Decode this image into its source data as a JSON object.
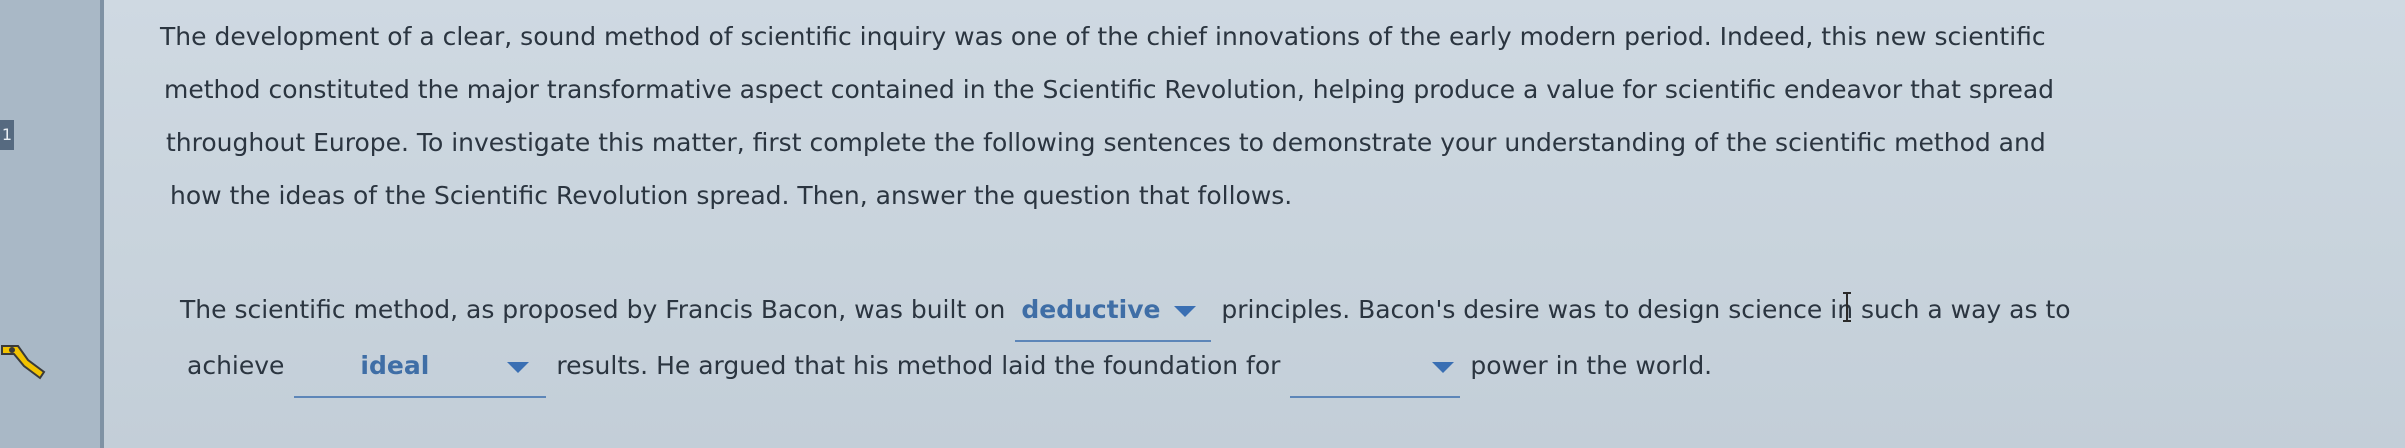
{
  "intro": {
    "lines": [
      "The development of a clear, sound method of scientific inquiry was one of the chief innovations of the early modern period. Indeed, this new scientific",
      "method constituted the major transformative aspect contained in the Scientific Revolution, helping produce a value for scientific endeavor that spread",
      "throughout Europe. To investigate this matter, first complete the following sentences to demonstrate your understanding of the scientific method and",
      "how the ideas of the Scientific Revolution spread. Then, answer the question that follows."
    ]
  },
  "question": {
    "segment1": "The scientific method, as proposed by Francis Bacon, was built on",
    "dropdown1": "deductive",
    "segment2": "principles. Bacon's desire was to design science in such a way as to",
    "segment3": "achieve",
    "dropdown2": "ideal",
    "segment4": "results. He argued that his method laid the foundation for",
    "dropdown3": "",
    "segment5": "power in the world."
  },
  "colors": {
    "background": "#c9d3dc",
    "text": "#2b3540",
    "dropdown_text": "#3f6ea6",
    "dropdown_arrow": "#3a6fb3"
  },
  "icons": [
    "wrench-tool-icon",
    "panel-marker-icon",
    "text-cursor-icon"
  ]
}
